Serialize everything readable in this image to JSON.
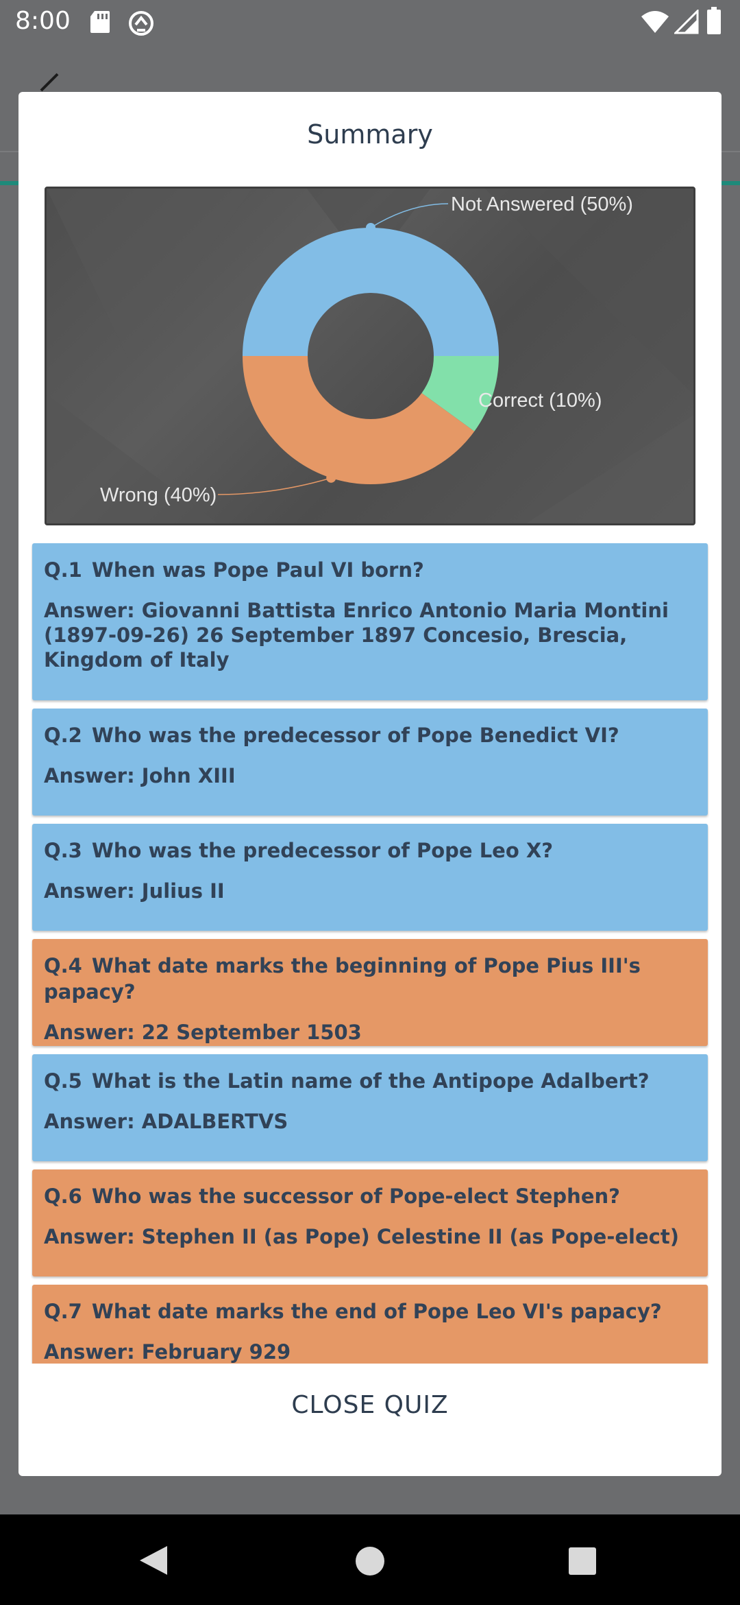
{
  "status_bar": {
    "time": "8:00",
    "icons": [
      "sd-card-icon",
      "sync-icon",
      "wifi-icon",
      "signal-icon",
      "battery-icon"
    ]
  },
  "dialog": {
    "title": "Summary",
    "close_label": "CLOSE QUIZ"
  },
  "chart_data": {
    "type": "pie",
    "style": "donut",
    "slices": [
      {
        "label": "Not Answered (50%)",
        "value": 50,
        "color": "#82bde6"
      },
      {
        "label": "Correct (10%)",
        "value": 10,
        "color": "#82e0aa"
      },
      {
        "label": "Wrong (40%)",
        "value": 40,
        "color": "#e59866"
      }
    ]
  },
  "questions": [
    {
      "number": "Q.1",
      "question": "When was Pope Paul VI born?",
      "answer": "Answer: Giovanni Battista Enrico Antonio Maria Montini (1897-09-26) 26 September 1897 Concesio, Brescia, Kingdom of Italy",
      "status": "not_answered"
    },
    {
      "number": "Q.2",
      "question": "Who was the predecessor of Pope Benedict VI?",
      "answer": "Answer: John XIII",
      "status": "not_answered"
    },
    {
      "number": "Q.3",
      "question": "Who was the predecessor of Pope Leo X?",
      "answer": "Answer: Julius II",
      "status": "not_answered"
    },
    {
      "number": "Q.4",
      "question": "What date marks the beginning of Pope Pius III's papacy?",
      "answer": "Answer: 22 September 1503",
      "status": "wrong"
    },
    {
      "number": "Q.5",
      "question": "What is the Latin name of the Antipope Adalbert?",
      "answer": "Answer: ADALBERTVS",
      "status": "not_answered"
    },
    {
      "number": "Q.6",
      "question": "Who was the successor of Pope-elect Stephen?",
      "answer": "Answer: Stephen II (as Pope) Celestine II (as Pope-elect)",
      "status": "wrong"
    },
    {
      "number": "Q.7",
      "question": "What date marks the end of Pope Leo VI's papacy?",
      "answer": "Answer: February 929",
      "status": "wrong"
    }
  ],
  "colors": {
    "not_answered": "#82bde6",
    "wrong": "#e59866",
    "correct": "#82e0aa"
  }
}
